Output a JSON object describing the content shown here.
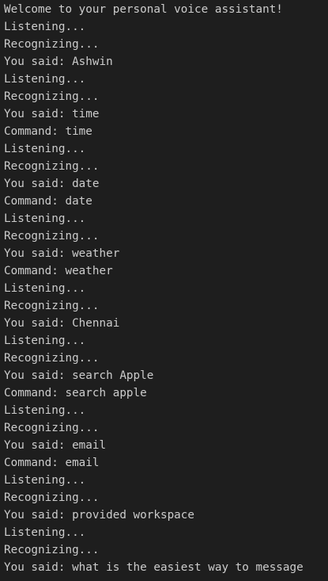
{
  "terminal": {
    "lines": [
      "Welcome to your personal voice assistant!",
      "Listening...",
      "Recognizing...",
      "You said: Ashwin",
      "Listening...",
      "Recognizing...",
      "You said: time",
      "Command: time",
      "Listening...",
      "Recognizing...",
      "You said: date",
      "Command: date",
      "Listening...",
      "Recognizing...",
      "You said: weather",
      "Command: weather",
      "Listening...",
      "Recognizing...",
      "You said: Chennai",
      "Listening...",
      "Recognizing...",
      "You said: search Apple",
      "Command: search apple",
      "Listening...",
      "Recognizing...",
      "You said: email",
      "Command: email",
      "Listening...",
      "Recognizing...",
      "You said: provided workspace",
      "Listening...",
      "Recognizing...",
      "You said: what is the easiest way to message"
    ],
    "colors": {
      "background": "#1e1e1e",
      "text": "#cccccc"
    }
  }
}
